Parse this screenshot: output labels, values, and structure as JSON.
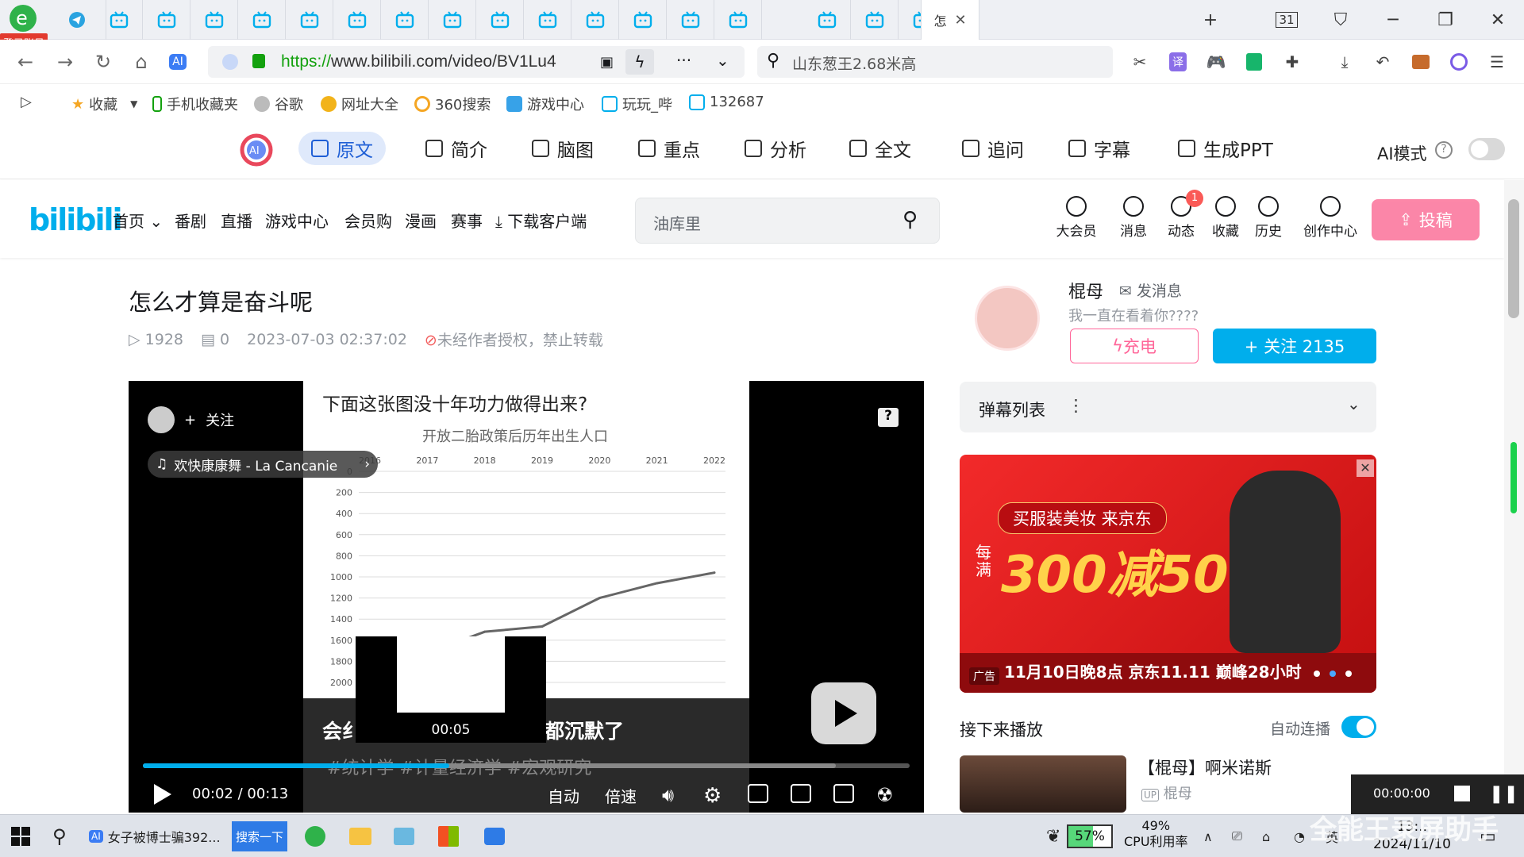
{
  "browser": {
    "account_label": "登录账号",
    "tabs_count": 17,
    "active_tab_title": "怎",
    "tab_counter": "31",
    "url_scheme": "https://",
    "url_rest": "www.bilibili.com/video/BV1Lu4",
    "search_query": "山东葱王2.68米高"
  },
  "bookmarks": [
    "收藏",
    "手机收藏夹",
    "谷歌",
    "网址大全",
    "360搜索",
    "游戏中心",
    "玩玩_哔",
    "132687"
  ],
  "ai_toolbar": {
    "tabs": [
      "原文",
      "简介",
      "脑图",
      "重点",
      "分析",
      "全文",
      "追问",
      "字幕",
      "生成PPT"
    ],
    "active": "原文",
    "mode_label": "AI模式"
  },
  "bili_header": {
    "logo": "bilibili",
    "nav": [
      "首页",
      "番剧",
      "直播",
      "游戏中心",
      "会员购",
      "漫画",
      "赛事",
      "下载客户端"
    ],
    "search_placeholder": "油库里",
    "icons": [
      "大会员",
      "消息",
      "动态",
      "收藏",
      "历史",
      "创作中心"
    ],
    "badge": "1",
    "upload_label": "投稿"
  },
  "video": {
    "title": "怎么才算是奋斗呢",
    "views": "1928",
    "danmaku_count": "0",
    "date": "2023-07-03 02:37:02",
    "rights": "未经作者授权，禁止转载"
  },
  "player": {
    "follow_label": "关注",
    "music": "欢快康康舞 - La Cancanie",
    "frame_caption": "下面这张图没十年功力做得出来?",
    "chart_title": "开放二胎政策后历年出生人口",
    "caption_left": "会纟",
    "caption_right": "都沉默了",
    "tags": "#统计学  #计量经济学  #宏观研究",
    "preview_time": "00:05",
    "current_time": "00:02",
    "duration": "00:13",
    "progress": 0.4,
    "buffered": 0.904,
    "controls": [
      "自动",
      "倍速"
    ]
  },
  "chart_data": {
    "type": "line",
    "title": "开放二胎政策后历年出生人口",
    "x": [
      "2016",
      "2017",
      "2018",
      "2019",
      "2020",
      "2021",
      "2022"
    ],
    "y_tick_labels": [
      "0",
      "200",
      "400",
      "600",
      "800",
      "1000",
      "1200",
      "1400",
      "1600",
      "1800",
      "2000"
    ],
    "ylim": [
      0,
      2000
    ],
    "y_inverted": true,
    "values": [
      1790,
      1720,
      1520,
      1470,
      1200,
      1060,
      960
    ],
    "grid": true
  },
  "uploader": {
    "name": "棍母",
    "message_label": "发消息",
    "signature": "我一直在看着你????",
    "charge_label": "充电",
    "follow_label": "+ 关注 2135"
  },
  "sidebar": {
    "danmaku_list": "弹幕列表",
    "ad_slogan": "买服装美妆 来京东",
    "ad_prefix": "每满",
    "ad_big": "300减50",
    "ad_bottom": "11月10日晚8点 京东11.11 巅峰28小时",
    "ad_tag": "广告",
    "up_next": "接下来播放",
    "autoplay": "自动连播",
    "rec_title": "【棍母】啊米诺斯",
    "rec_up": "棍母",
    "recorder_time": "00:00:00"
  },
  "taskbar": {
    "app1": "女子被博士骗392...",
    "search_btn": "搜索一下",
    "battery": "57%",
    "cpu_pct": "49%",
    "cpu_label": "CPU利用率",
    "time": "13:..",
    "date": "2024/11/10",
    "watermark": "全能王录屏助手"
  },
  "colors": {
    "bili_blue": "#00aeec",
    "bili_pink": "#fb7299",
    "ai_active": "#1f5fd6"
  }
}
